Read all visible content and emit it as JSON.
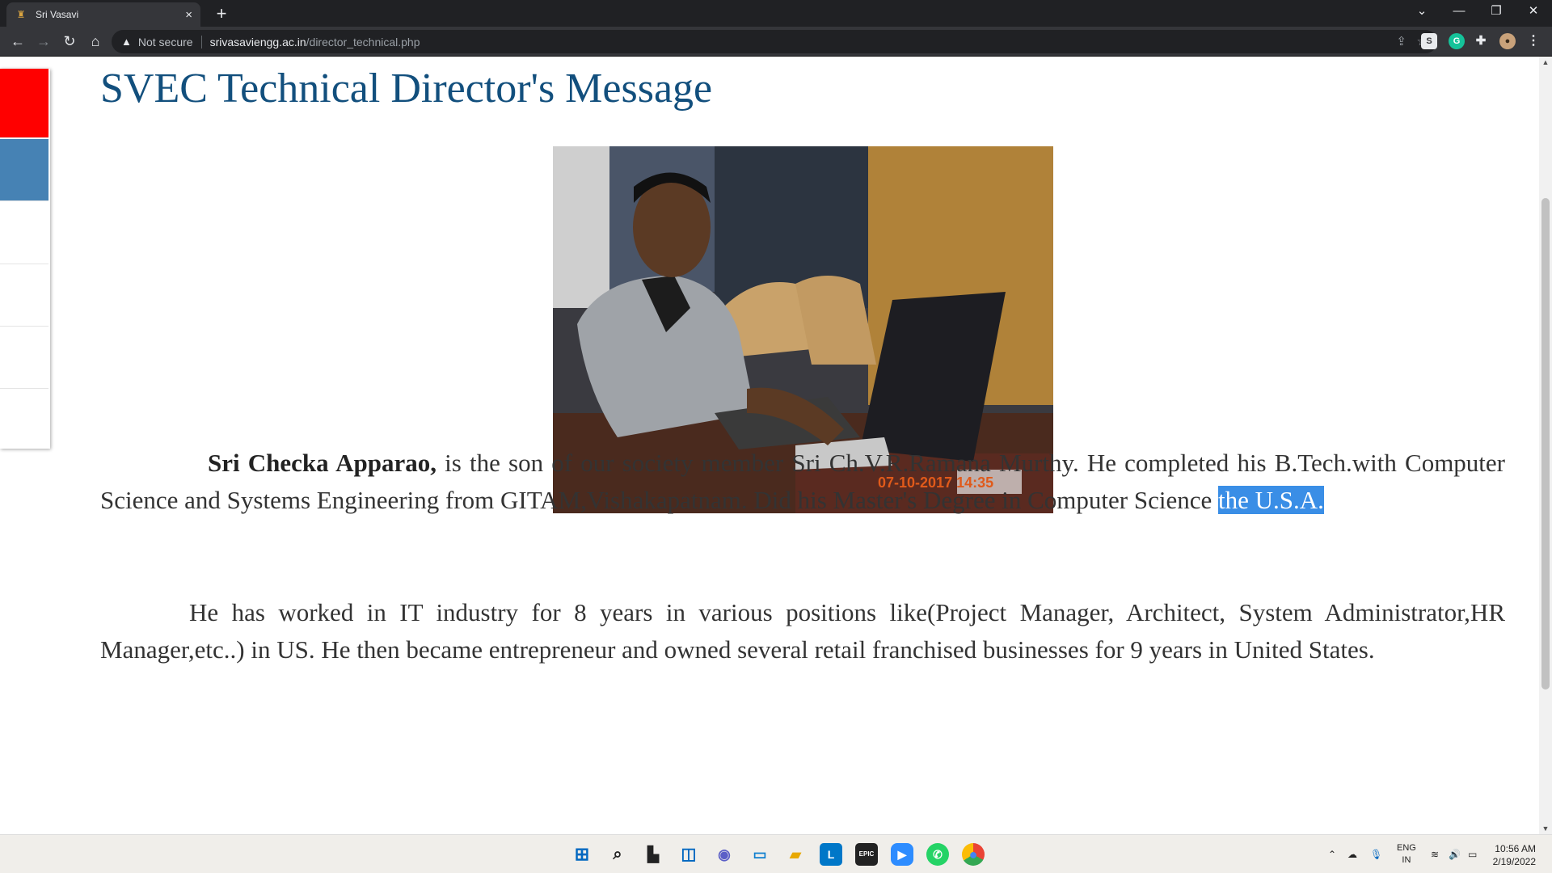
{
  "browser": {
    "tab_title": "Sri Vasavi",
    "tab_close": "×",
    "new_tab": "+",
    "omnibox": {
      "security_label": "Not secure",
      "host": "srivasaviengg.ac.in",
      "path": "/director_technical.php"
    }
  },
  "page": {
    "heading": "SVEC Technical Director's Message",
    "photo_timestamp": "07-10-2017 14:35",
    "para1": {
      "name": "Sri Checka Apparao,",
      "text": " is the son of our society member Sri Ch.V.R.Ramana Murthy. He completed his B.Tech.with Computer Science and Systems Engineering from GITAM,Vishakapatnam. Did his Master's Degree in Computer Science ",
      "highlighted": "the U.S.A."
    },
    "para2": "He has worked in IT industry for 8 years in various positions like(Project Manager, Architect, System Administrator,HR Manager,etc..) in US. He then became entrepreneur and owned several retail franchised businesses for 9 years in United States."
  },
  "sidebar": {
    "colors": [
      "#ff0000",
      "#4682b4"
    ]
  },
  "taskbar": {
    "language": "ENG",
    "region": "IN",
    "time": "10:56 AM",
    "date": "2/19/2022",
    "epic_label": "EPIC",
    "l_label": "L"
  },
  "colors": {
    "heading": "#124f7d",
    "selection": "#3a8ee6",
    "chrome_dark": "#202124"
  }
}
